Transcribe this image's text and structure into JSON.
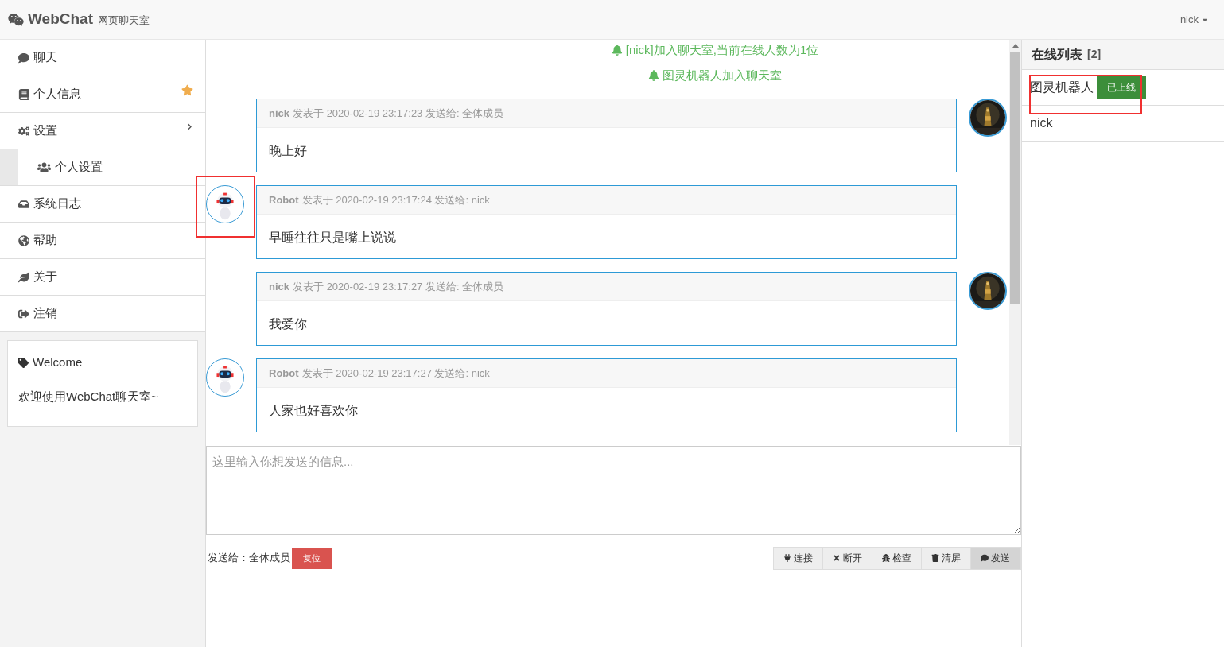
{
  "navbar": {
    "brand": "WebChat",
    "subtitle": "网页聊天室",
    "user": "nick"
  },
  "sidebar": {
    "items": [
      {
        "label": "聊天",
        "kind": "plain"
      },
      {
        "label": "个人信息",
        "kind": "starred"
      },
      {
        "label": "设置",
        "kind": "expandable",
        "children": [
          {
            "label": "个人设置"
          }
        ]
      },
      {
        "label": "系统日志",
        "kind": "plain"
      },
      {
        "label": "帮助",
        "kind": "plain"
      },
      {
        "label": "关于",
        "kind": "plain"
      },
      {
        "label": "注销",
        "kind": "plain"
      }
    ],
    "panel": {
      "title": "Welcome",
      "text": "欢迎使用WebChat聊天室~"
    }
  },
  "notices": [
    "[nick]加入聊天室,当前在线人数为1位",
    "图灵机器人加入聊天室"
  ],
  "messages": [
    {
      "kind": "sent",
      "sender": "nick",
      "meta": "发表于 2020-02-19 23:17:23 发送给: 全体成员",
      "text": "晚上好",
      "highlighted": false
    },
    {
      "kind": "received",
      "sender": "Robot",
      "meta": "发表于 2020-02-19 23:17:24 发送给: nick",
      "text": "早睡往往只是嘴上说说",
      "highlighted": true
    },
    {
      "kind": "sent",
      "sender": "nick",
      "meta": "发表于 2020-02-19 23:17:27 发送给: 全体成员",
      "text": "我爱你",
      "highlighted": false
    },
    {
      "kind": "received",
      "sender": "Robot",
      "meta": "发表于 2020-02-19 23:17:27 发送给: nick",
      "text": "人家也好喜欢你",
      "highlighted": false
    }
  ],
  "input": {
    "placeholder": "这里输入你想发送的信息..."
  },
  "send_to": {
    "label": "发送给：全体成员",
    "reset": "复位"
  },
  "actions": [
    {
      "label": "连接",
      "selected": false
    },
    {
      "label": "断开",
      "selected": false
    },
    {
      "label": "检查",
      "selected": false
    },
    {
      "label": "清屏",
      "selected": false
    },
    {
      "label": "发送",
      "selected": true
    }
  ],
  "online": {
    "title": "在线列表",
    "count": "[2]",
    "users": [
      {
        "name": "图灵机器人",
        "badge": "已上线",
        "highlighted": true
      },
      {
        "name": "nick",
        "highlighted": false
      }
    ]
  }
}
